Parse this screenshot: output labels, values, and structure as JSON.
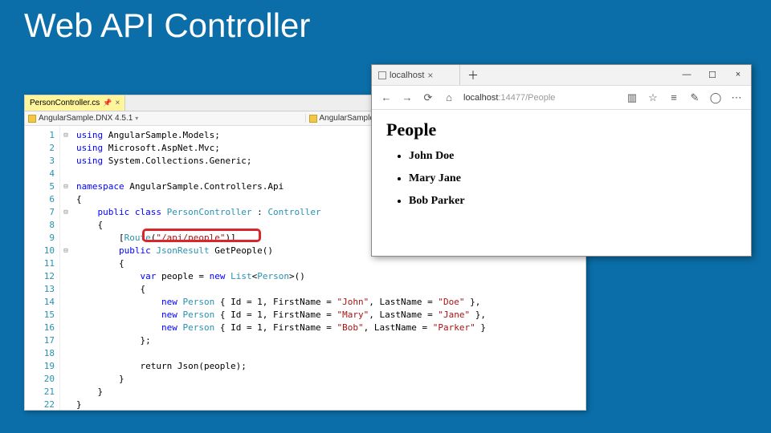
{
  "slide": {
    "title": "Web API Controller"
  },
  "vs": {
    "tab": {
      "filename": "PersonController.cs"
    },
    "crumb_left": "AngularSample.DNX 4.5.1",
    "crumb_right": "AngularSample.Contro",
    "lines": [
      "1",
      "2",
      "3",
      "4",
      "5",
      "6",
      "7",
      "8",
      "9",
      "10",
      "11",
      "12",
      "13",
      "14",
      "15",
      "16",
      "17",
      "18",
      "19",
      "20",
      "21",
      "22"
    ],
    "code": {
      "l1a": "using",
      "l1b": " AngularSample.Models;",
      "l2a": "using",
      "l2b": " Microsoft.AspNet.Mvc;",
      "l3a": "using",
      "l3b": " System.Collections.Generic;",
      "l5a": "namespace",
      "l5b": " AngularSample.Controllers.Api",
      "l6": "{",
      "l7a": "    public class ",
      "l7b": "PersonController",
      "l7c": " : ",
      "l7d": "Controller",
      "l8": "    {",
      "l9a": "        [",
      "l9b": "Route",
      "l9c": "(",
      "l9d": "\"/api/people\"",
      "l9e": ")]",
      "l10a": "        public ",
      "l10b": "JsonResult",
      "l10c": " GetPeople()",
      "l11": "        {",
      "l12a": "            var",
      "l12b": " people = ",
      "l12c": "new ",
      "l12d": "List",
      "l12e": "<",
      "l12f": "Person",
      "l12g": ">()",
      "l13": "            {",
      "l14a": "                new ",
      "l14b": "Person",
      "l14c": " { Id = 1, FirstName = ",
      "l14d": "\"John\"",
      "l14e": ", LastName = ",
      "l14f": "\"Doe\"",
      "l14g": " },",
      "l15a": "                new ",
      "l15b": "Person",
      "l15c": " { Id = 1, FirstName = ",
      "l15d": "\"Mary\"",
      "l15e": ", LastName = ",
      "l15f": "\"Jane\"",
      "l15g": " },",
      "l16a": "                new ",
      "l16b": "Person",
      "l16c": " { Id = 1, FirstName = ",
      "l16d": "\"Bob\"",
      "l16e": ", LastName = ",
      "l16f": "\"Parker\"",
      "l16g": " }",
      "l17": "            };",
      "l19": "            return Json(people);",
      "l20": "        }",
      "l21": "    }",
      "l22": "}"
    }
  },
  "edge": {
    "tab_title": "localhost",
    "url_host": "localhost",
    "url_rest": ":14477/People",
    "page_heading": "People",
    "people": [
      "John Doe",
      "Mary Jane",
      "Bob Parker"
    ]
  }
}
